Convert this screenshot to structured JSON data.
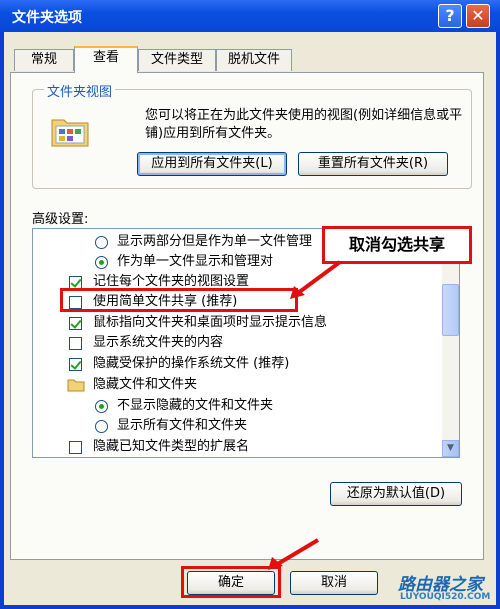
{
  "window": {
    "title": "文件夹选项",
    "help_glyph": "?",
    "close_glyph": "✕"
  },
  "tabs": [
    {
      "label": "常规"
    },
    {
      "label": "查看",
      "active": true
    },
    {
      "label": "文件类型"
    },
    {
      "label": "脱机文件"
    }
  ],
  "folder_views": {
    "legend": "文件夹视图",
    "description": "您可以将正在为此文件夹使用的视图(例如详细信息或平铺)应用到所有文件夹。",
    "apply_button": "应用到所有文件夹(L)",
    "reset_button": "重置所有文件夹(R)"
  },
  "advanced": {
    "label": "高级设置:",
    "items": [
      {
        "kind": "radio",
        "checked": false,
        "indent": 2,
        "label": "显示两部分但是作为单一文件管理"
      },
      {
        "kind": "radio",
        "checked": true,
        "indent": 2,
        "label": "作为单一文件显示和管理对"
      },
      {
        "kind": "checkbox",
        "checked": true,
        "indent": 1,
        "label": "记住每个文件夹的视图设置"
      },
      {
        "kind": "checkbox",
        "checked": false,
        "indent": 1,
        "label": "使用简单文件共享 (推荐)"
      },
      {
        "kind": "checkbox",
        "checked": true,
        "indent": 1,
        "label": "鼠标指向文件夹和桌面项时显示提示信息"
      },
      {
        "kind": "checkbox",
        "checked": false,
        "indent": 1,
        "label": "显示系统文件夹的内容"
      },
      {
        "kind": "checkbox",
        "checked": true,
        "indent": 1,
        "label": "隐藏受保护的操作系统文件 (推荐)"
      },
      {
        "kind": "folder",
        "indent": 1,
        "label": "隐藏文件和文件夹"
      },
      {
        "kind": "radio",
        "checked": true,
        "indent": 2,
        "label": "不显示隐藏的文件和文件夹"
      },
      {
        "kind": "radio",
        "checked": false,
        "indent": 2,
        "label": "显示所有文件和文件夹"
      },
      {
        "kind": "checkbox",
        "checked": false,
        "indent": 1,
        "label": "隐藏已知文件类型的扩展名"
      }
    ],
    "restore_button": "还原为默认值(D)"
  },
  "callout": {
    "text": "取消勾选共享"
  },
  "footer": {
    "ok_button": "确定",
    "cancel_button": "取消"
  },
  "watermark": {
    "cn": "路由器之家",
    "en": "LUYOUQI520.COM"
  },
  "colors": {
    "annotation_red": "#e01010",
    "title_blue": "#0a4fe0"
  }
}
